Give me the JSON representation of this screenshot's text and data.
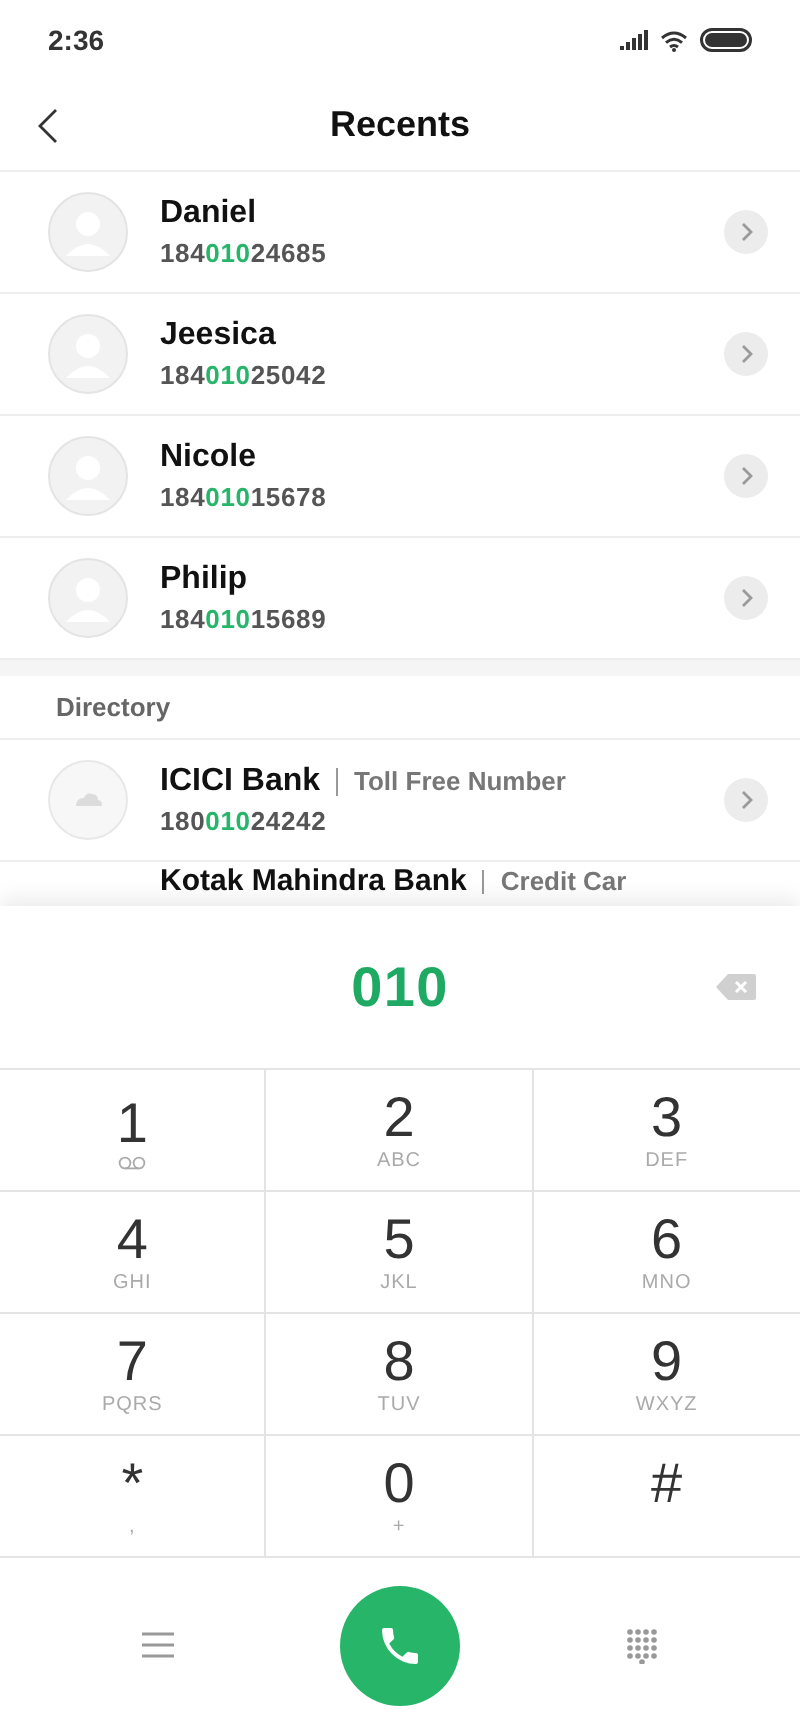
{
  "status_bar": {
    "time": "2:36"
  },
  "header": {
    "title": "Recents"
  },
  "recents": [
    {
      "name": "Daniel",
      "number": {
        "before": "184",
        "match": "010",
        "after": "24685"
      }
    },
    {
      "name": "Jeesica",
      "number": {
        "before": "184",
        "match": "010",
        "after": "25042"
      }
    },
    {
      "name": "Nicole",
      "number": {
        "before": "184",
        "match": "010",
        "after": "15678"
      }
    },
    {
      "name": "Philip",
      "number": {
        "before": "184",
        "match": "010",
        "after": "15689"
      }
    }
  ],
  "directory": {
    "title": "Directory",
    "items": [
      {
        "name": "ICICI Bank",
        "tag": "Toll Free Number",
        "number": {
          "before": "180",
          "match": "010",
          "after": "24242"
        }
      },
      {
        "name": "Kotak Mahindra Bank",
        "tag": "Credit Car"
      }
    ]
  },
  "dialer": {
    "entered": "010",
    "keys": [
      {
        "digit": "1",
        "kind": "voicemail"
      },
      {
        "digit": "2",
        "kind": "letters",
        "letters": "ABC"
      },
      {
        "digit": "3",
        "kind": "letters",
        "letters": "DEF"
      },
      {
        "digit": "4",
        "kind": "letters",
        "letters": "GHI"
      },
      {
        "digit": "5",
        "kind": "letters",
        "letters": "JKL"
      },
      {
        "digit": "6",
        "kind": "letters",
        "letters": "MNO"
      },
      {
        "digit": "7",
        "kind": "letters",
        "letters": "PQRS"
      },
      {
        "digit": "8",
        "kind": "letters",
        "letters": "TUV"
      },
      {
        "digit": "9",
        "kind": "letters",
        "letters": "WXYZ"
      },
      {
        "digit": "*",
        "kind": "letters",
        "letters": ","
      },
      {
        "digit": "0",
        "kind": "letters",
        "letters": "+"
      },
      {
        "digit": "#",
        "kind": "plain"
      }
    ]
  }
}
